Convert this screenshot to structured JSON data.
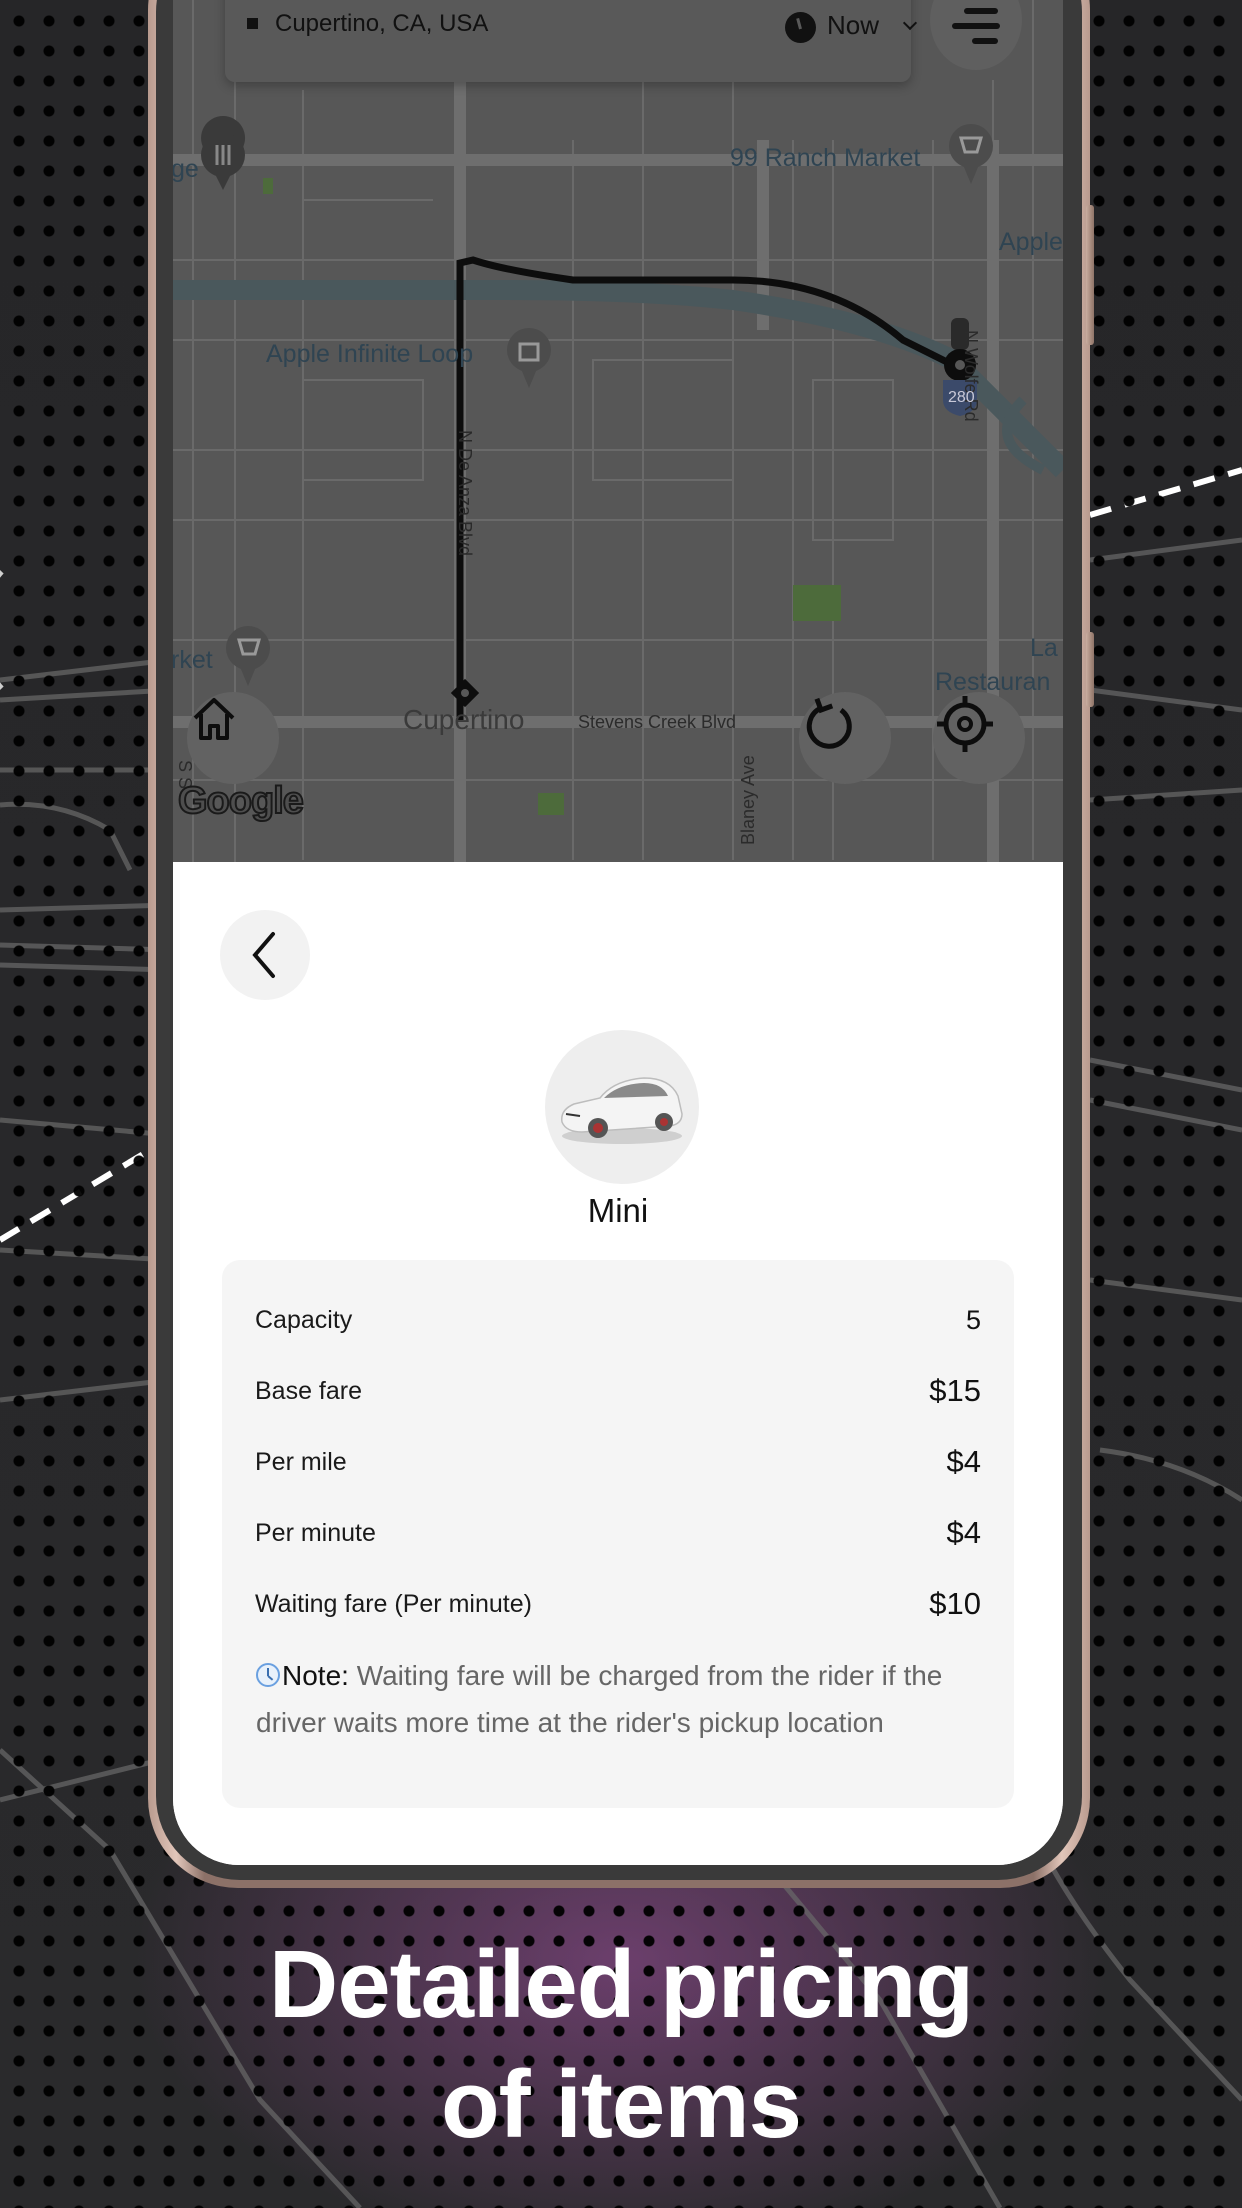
{
  "map": {
    "location": "Cupertino, CA, USA",
    "time_selector": "Now",
    "labels": {
      "ranch_market": "99 Ranch Market",
      "apple_infinite_loop": "Apple Infinite Loop",
      "apple_partial": "Apple",
      "n_wolfe_rd": "N Wolfe Rd",
      "n_de_anza_blvd": "N De Anza Blvd",
      "highway_280": "280",
      "cupertino": "Cupertino",
      "stevens_creek_blvd": "Stevens Creek Blvd",
      "blaney_ave": "Blaney Ave",
      "market_partial": "rket",
      "ge_partial": "ge",
      "la_partial": "La",
      "restaurant_partial": "Restauran",
      "s_partial": "S S",
      "google": "Google"
    },
    "icons": [
      "menu-icon",
      "home-icon",
      "refresh-icon",
      "locate-icon",
      "restaurant-pin-icon",
      "shopping-cart-pin-icon",
      "shopping-bag-pin-icon"
    ]
  },
  "vehicle": {
    "name": "Mini",
    "image": "white-suv-car"
  },
  "pricing": {
    "rows": [
      {
        "label": "Capacity",
        "value": "5"
      },
      {
        "label": "Base fare",
        "value": "$15"
      },
      {
        "label": "Per mile",
        "value": "$4"
      },
      {
        "label": "Per minute",
        "value": "$4"
      },
      {
        "label": "Waiting fare (Per minute)",
        "value": "$10"
      }
    ],
    "note_title": "Note:",
    "note_text": " Waiting fare will be charged from the rider if the driver waits more time at the rider's pickup location"
  },
  "headline": {
    "line1": "Detailed pricing",
    "line2": "of items"
  }
}
